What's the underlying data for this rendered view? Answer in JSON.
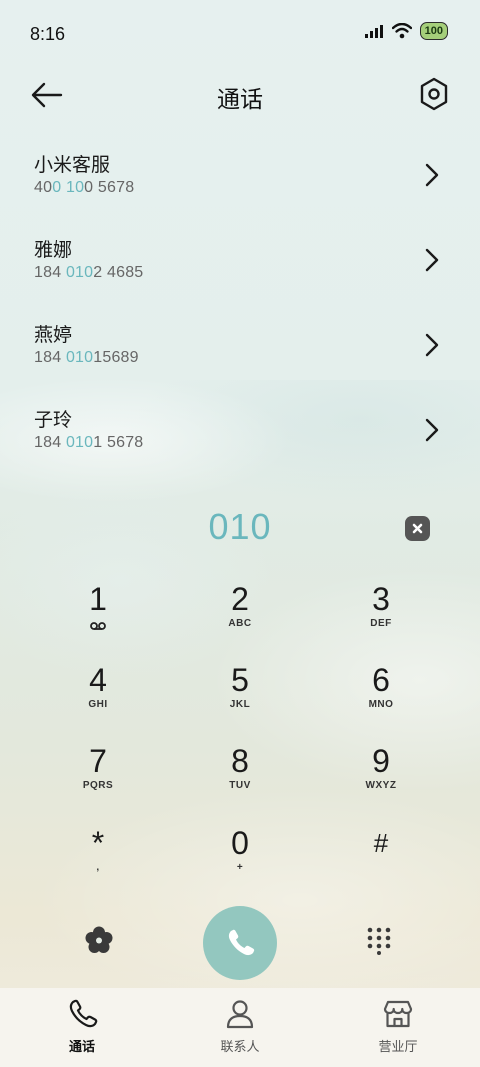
{
  "status_bar": {
    "time": "8:16",
    "battery": "100"
  },
  "header": {
    "title": "通话"
  },
  "results": [
    {
      "name": "小米客服",
      "num_parts": [
        {
          "t": "40",
          "hl": false
        },
        {
          "t": "0",
          "hl": true
        },
        {
          "t": " ",
          "hl": false
        },
        {
          "t": "10",
          "hl": true
        },
        {
          "t": "0 5678",
          "hl": false
        }
      ]
    },
    {
      "name": "雅娜",
      "num_parts": [
        {
          "t": "184 ",
          "hl": false
        },
        {
          "t": "010",
          "hl": true
        },
        {
          "t": "2 4685",
          "hl": false
        }
      ]
    },
    {
      "name": "燕婷",
      "num_parts": [
        {
          "t": "184 ",
          "hl": false
        },
        {
          "t": "010",
          "hl": true
        },
        {
          "t": "15689",
          "hl": false
        }
      ]
    },
    {
      "name": "子玲",
      "num_parts": [
        {
          "t": "184 ",
          "hl": false
        },
        {
          "t": "010",
          "hl": true
        },
        {
          "t": "1 5678",
          "hl": false
        }
      ]
    }
  ],
  "dialer": {
    "number": "010"
  },
  "keys": [
    {
      "digit": "1",
      "letters": ""
    },
    {
      "digit": "2",
      "letters": "ABC"
    },
    {
      "digit": "3",
      "letters": "DEF"
    },
    {
      "digit": "4",
      "letters": "GHI"
    },
    {
      "digit": "5",
      "letters": "JKL"
    },
    {
      "digit": "6",
      "letters": "MNO"
    },
    {
      "digit": "7",
      "letters": "PQRS"
    },
    {
      "digit": "8",
      "letters": "TUV"
    },
    {
      "digit": "9",
      "letters": "WXYZ"
    },
    {
      "digit": "*",
      "letters": ","
    },
    {
      "digit": "0",
      "letters": "+"
    },
    {
      "digit": "#",
      "letters": ""
    }
  ],
  "nav": {
    "calls": "通话",
    "contacts": "联系人",
    "store": "营业厅"
  },
  "colors": {
    "accent": "#6ab7bd",
    "call_button": "#93c7bf"
  }
}
